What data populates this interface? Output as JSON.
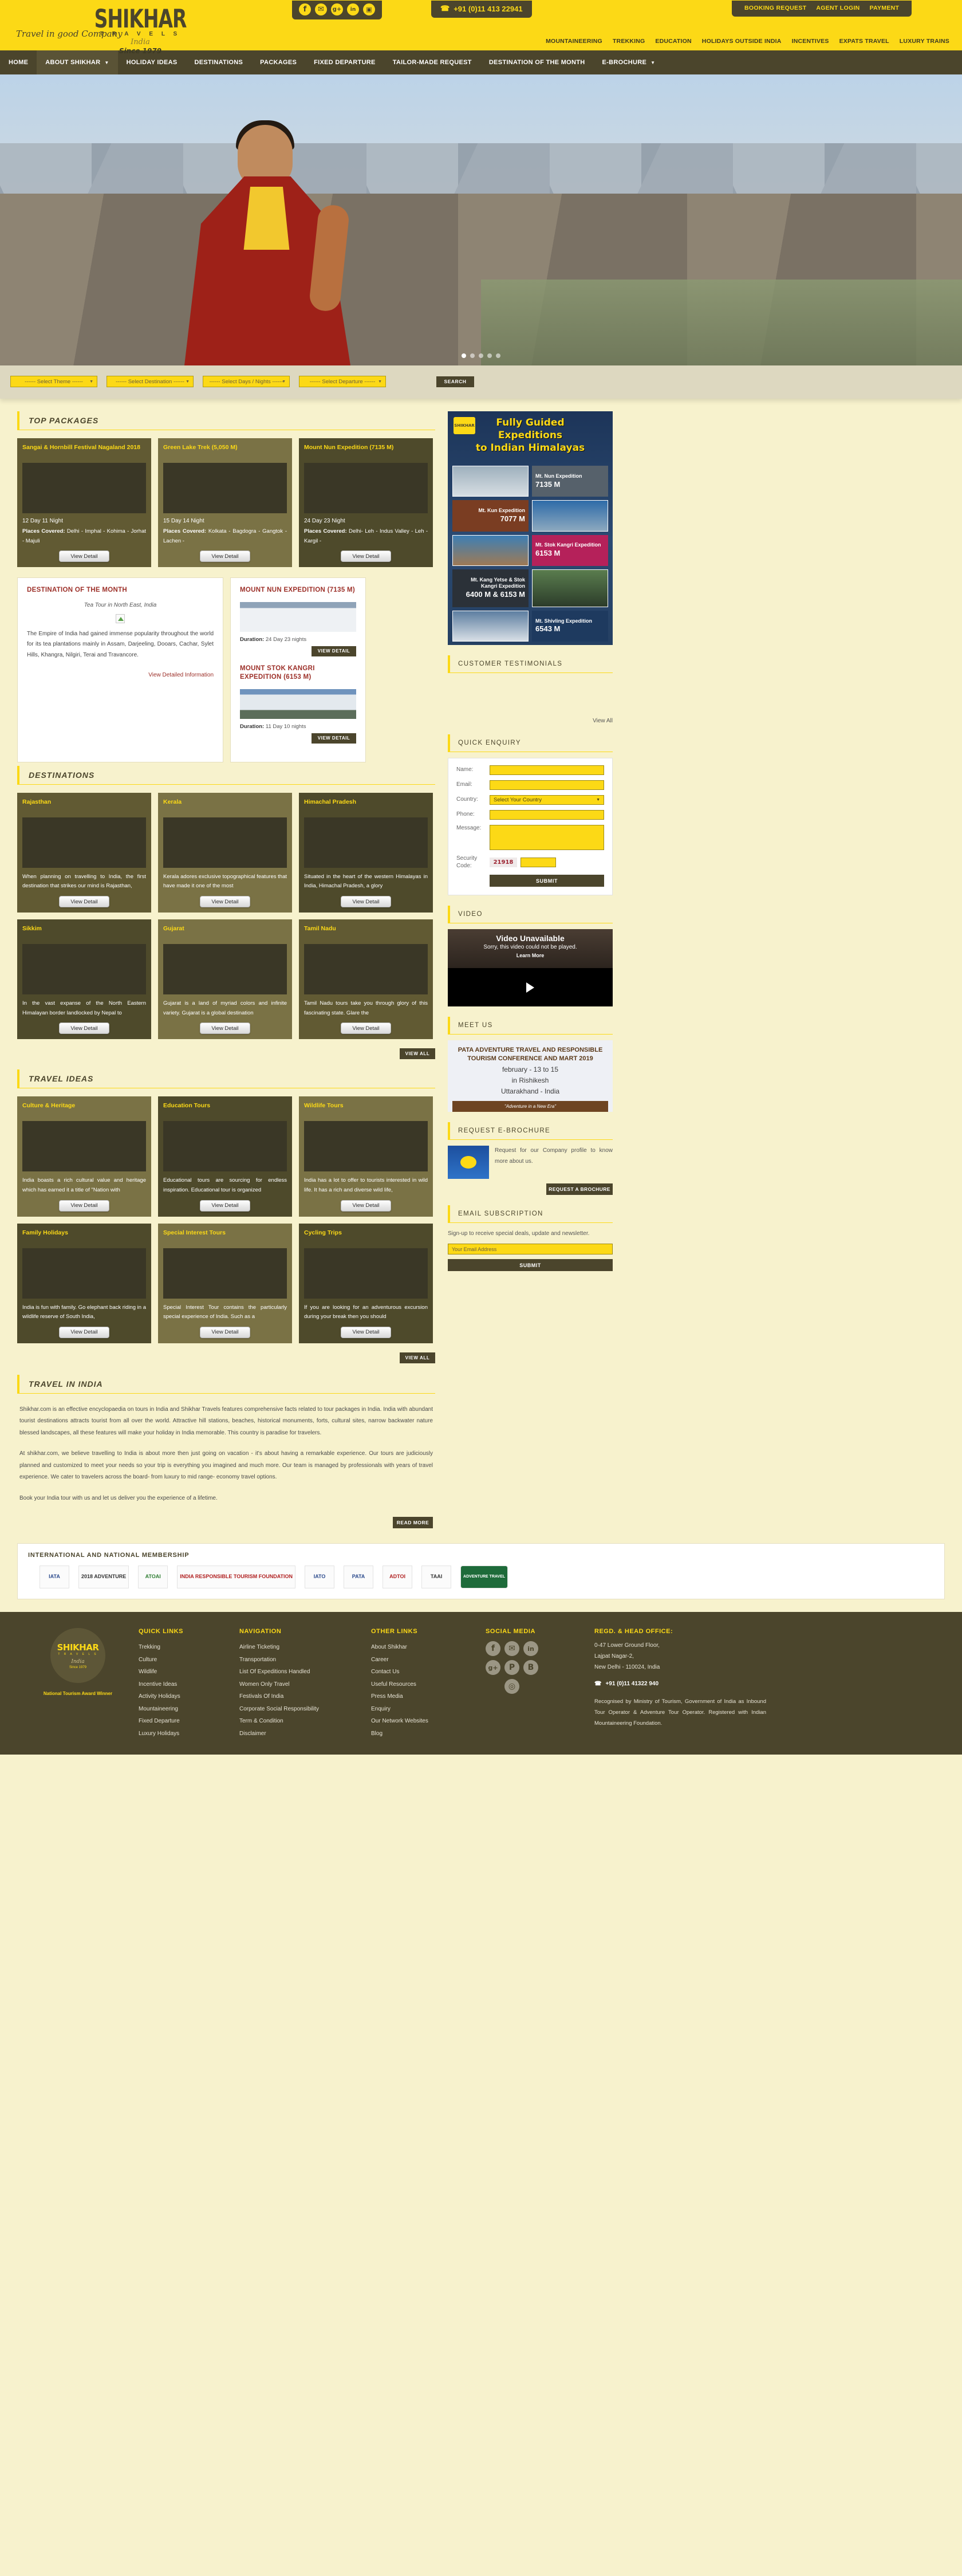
{
  "header": {
    "logo": {
      "name": "SHIKHAR",
      "sub": "T R A V E L S",
      "script": "India",
      "since": "Since 1979"
    },
    "tagline": "Travel in good Company",
    "phone": "+91 (0)11 413 22941",
    "social": [
      {
        "name": "facebook-icon",
        "glyph": "f"
      },
      {
        "name": "twitter-icon",
        "glyph": "✉"
      },
      {
        "name": "googleplus-icon",
        "glyph": "g+"
      },
      {
        "name": "linkedin-icon",
        "glyph": "in"
      },
      {
        "name": "instagram-icon",
        "glyph": "▣"
      }
    ],
    "top_links": [
      "BOOKING REQUEST",
      "AGENT LOGIN",
      "PAYMENT"
    ],
    "category_links": [
      "MOUNTAINEERING",
      "TREKKING",
      "EDUCATION",
      "HOLIDAYS OUTSIDE INDIA",
      "INCENTIVES",
      "EXPATS TRAVEL",
      "LUXURY TRAINS"
    ]
  },
  "nav": [
    {
      "label": "HOME",
      "caret": false,
      "active": false
    },
    {
      "label": "ABOUT SHIKHAR",
      "caret": true,
      "active": true
    },
    {
      "label": "HOLIDAY IDEAS",
      "caret": false,
      "active": false
    },
    {
      "label": "DESTINATIONS",
      "caret": false,
      "active": false
    },
    {
      "label": "PACKAGES",
      "caret": false,
      "active": false
    },
    {
      "label": "FIXED DEPARTURE",
      "caret": false,
      "active": false
    },
    {
      "label": "TAILOR-MADE REQUEST",
      "caret": false,
      "active": false
    },
    {
      "label": "DESTINATION OF THE MONTH",
      "caret": false,
      "active": false
    },
    {
      "label": "E-BROCHURE",
      "caret": true,
      "active": false
    }
  ],
  "search": {
    "theme": "------ Select Theme ------",
    "destination": "------ Select Destination ------",
    "days": "------ Select Days / Nights ------",
    "departure": "------ Select Departure ------",
    "button": "SEARCH"
  },
  "sections": {
    "top_packages": "TOP PACKAGES",
    "destinations": "DESTINATIONS",
    "travel_ideas": "TRAVEL IDEAS",
    "travel_in_india": "TRAVEL IN INDIA"
  },
  "top_packages": [
    {
      "title": "Sangai & Hornbill Festival Nagaland 2018",
      "duration": "12 Day 11 Night",
      "places_label": "Places Covered:",
      "places": "Delhi - Imphal - Kohima - Jorhat - Majuli",
      "button": "View Detail"
    },
    {
      "title": "Green Lake Trek (5,050 M)",
      "duration": "15 Day 14 Night",
      "places_label": "Places Covered:",
      "places": "Kolkata - Bagdogra - Gangtok - Lachen -",
      "button": "View Detail"
    },
    {
      "title": "Mount Nun Expedition (7135 M)",
      "duration": "24 Day 23 Night",
      "places_label": "Places Covered:",
      "places": "Delhi- Leh - Indus Valley - Leh - Kargil -",
      "button": "View Detail"
    }
  ],
  "destination_of_month": {
    "heading": "DESTINATION OF THE MONTH",
    "subtitle": "Tea Tour in North East, India",
    "text": "The Empire of India had gained immense popularity throughout the world for its tea plantations mainly in Assam, Darjeeling, Dooars, Cachar, Sylet Hills, Khangra, Nilgiri, Terai and Travancore.",
    "link": "View Detailed Information"
  },
  "expeditions": [
    {
      "title": "MOUNT NUN EXPEDITION (7135 M)",
      "duration_label": "Duration:",
      "duration": "24 Day 23 nights",
      "button": "VIEW DETAIL"
    },
    {
      "title": "MOUNT STOK KANGRI EXPEDITION (6153 M)",
      "duration_label": "Duration:",
      "duration": "11 Day 10 nights",
      "button": "VIEW DETAIL"
    }
  ],
  "destinations": [
    {
      "title": "Rajasthan",
      "text": "When planning on travelling to India, the first destination that strikes our mind is Rajasthan,",
      "button": "View Detail"
    },
    {
      "title": "Kerala",
      "text": "Kerala adores exclusive topographical features that have made it one of the most",
      "button": "View Detail"
    },
    {
      "title": "Himachal Pradesh",
      "text": "Situated in the heart of the western Himalayas in India, Himachal Pradesh, a glory",
      "button": "View Detail"
    },
    {
      "title": "Sikkim",
      "text": "In the vast expanse of the North Eastern Himalayan border landlocked by Nepal to",
      "button": "View Detail"
    },
    {
      "title": "Gujarat",
      "text": "Gujarat is a land of myriad colors and infinite variety. Gujarat is a global destination",
      "button": "View Detail"
    },
    {
      "title": "Tamil Nadu",
      "text": "Tamil Nadu tours take you through glory of this fascinating state. Glare the",
      "button": "View Detail"
    }
  ],
  "destinations_viewall": "VIEW ALL",
  "travel_ideas": [
    {
      "title": "Culture & Heritage",
      "text": "India boasts a rich cultural value and heritage which has earned it a title of \"Nation with",
      "button": "View Detail"
    },
    {
      "title": "Education Tours",
      "text": "Educational tours are sourcing for endless inspiration. Educational tour is organized",
      "button": "View Detail"
    },
    {
      "title": "Wildlife Tours",
      "text": "India has a lot to offer to tourists interested in wild life. It has a rich and diverse wild life,",
      "button": "View Detail"
    },
    {
      "title": "Family Holidays",
      "text": "India is fun with family. Go elephant back riding in a wildlife reserve of South India,",
      "button": "View Detail"
    },
    {
      "title": "Special Interest Tours",
      "text": "Special Interest Tour contains the particularly special experience of India. Such as a",
      "button": "View Detail"
    },
    {
      "title": "Cycling Trips",
      "text": "If you are looking for an adventurous excursion during your break then you should",
      "button": "View Detail"
    }
  ],
  "travel_ideas_viewall": "VIEW ALL",
  "travel_in_india": {
    "p1": "Shikhar.com is an effective encyclopaedia on tours in India and Shikhar Travels features comprehensive facts related to tour packages in India. India with abundant tourist destinations attracts tourist from all over the world. Attractive hill stations, beaches, historical monuments, forts, cultural sites, narrow backwater nature blessed landscapes, all these features will make your holiday in India memorable. This country is paradise for travelers.",
    "p2": "At shikhar.com, we believe travelling to India is about more then just going on vacation - it's about having a remarkable experience. Our tours are judiciously planned and customized to meet your needs so your trip is everything you imagined and much more. Our team is managed by professionals with years of travel experience. We cater to travelers across the board- from luxury to mid range- economy travel options.",
    "p3": "Book your India tour with us and let us deliver you the experience of a lifetime.",
    "button": "READ MORE"
  },
  "sidebar": {
    "banner": {
      "logo": "SHIKHAR",
      "title_line1": "Fully Guided",
      "title_line2": "Expeditions",
      "title_line3": "to Indian Himalayas",
      "cells": [
        {
          "text": "Mt. Nun Expedition",
          "value": "7135 M"
        },
        {
          "text": "Mt. Kun Expedition",
          "value": "7077 M"
        },
        {
          "text": "Mt. Stok Kangri Expedition",
          "value": "6153 M"
        },
        {
          "text": "Mt. Kang Yetse & Stok Kangri Expedition",
          "value": "6400 M & 6153 M"
        },
        {
          "text": "Mt. Shivling Expedition",
          "value": "6543 M"
        }
      ]
    },
    "testimonials_heading": "CUSTOMER TESTIMONIALS",
    "testimonials_viewall": "View All",
    "quick_enquiry": {
      "heading": "QUICK ENQUIRY",
      "name_label": "Name:",
      "email_label": "Email:",
      "country_label": "Country:",
      "country_value": "Select Your Country",
      "phone_label": "Phone:",
      "message_label": "Message:",
      "security_label": "Security Code:",
      "captcha": "21918",
      "submit": "SUBMIT"
    },
    "video": {
      "heading": "VIDEO",
      "title": "Video Unavailable",
      "subtitle": "Sorry, this video could not be played.",
      "link": "Learn More"
    },
    "meet_us": {
      "heading": "MEET US",
      "line1": "PATA ADVENTURE TRAVEL AND RESPONSIBLE TOURISM CONFERENCE AND MART  2019",
      "line2": "february - 13 to 15",
      "line3": "in Rishikesh",
      "line4": "Uttarakhand - India",
      "strip": "\"Adventure in a New Era\""
    },
    "ebrochure": {
      "heading": "REQUEST E-BROCHURE",
      "text": "Request for our Company profile to know more about us.",
      "button": "REQUEST A BROCHURE"
    },
    "subscription": {
      "heading": "EMAIL SUBSCRIPTION",
      "text": "Sign-up to receive special deals, update and newsletter.",
      "placeholder": "Your Email Address",
      "button": "SUBMIT"
    }
  },
  "memberships": {
    "heading": "INTERNATIONAL AND NATIONAL MEMBERSHIP",
    "logos": [
      "IATA",
      "2018 ADVENTURE",
      "ATOAI",
      "INDIA RESPONSIBLE TOURISM FOUNDATION",
      "IATO",
      "PATA",
      "ADTOI",
      "TAAI",
      "ADVENTURE TRAVEL"
    ]
  },
  "footer": {
    "brand": {
      "name": "SHIKHAR",
      "sub": "T R A V E L S",
      "script": "India",
      "since": "Since 1979"
    },
    "award": "National Tourism Award Winner",
    "quick_links_heading": "QUICK LINKS",
    "quick_links": [
      "Trekking",
      "Culture",
      "Wildlife",
      "Incentive Ideas",
      "Activity Holidays",
      "Mountaineering",
      "Fixed Departure",
      "Luxury Holidays"
    ],
    "navigation_heading": "NAVIGATION",
    "navigation": [
      "Airline Ticketing",
      "Transportation",
      "List Of Expeditions Handled",
      "Women Only Travel",
      "Festivals Of India",
      "Corporate Social Responsibility",
      "Term & Condition",
      "Disclaimer"
    ],
    "other_heading": "OTHER LINKS",
    "other_links": [
      "About Shikhar",
      "Career",
      "Contact Us",
      "Useful Resources",
      "Press Media",
      "Enquiry",
      "Our Network Websites",
      "Blog"
    ],
    "social_heading": "SOCIAL MEDIA",
    "social": [
      {
        "name": "facebook-icon",
        "glyph": "f"
      },
      {
        "name": "twitter-icon",
        "glyph": "✉"
      },
      {
        "name": "linkedin-icon",
        "glyph": "in"
      },
      {
        "name": "googleplus-icon",
        "glyph": "g+"
      },
      {
        "name": "pinterest-icon",
        "glyph": "P"
      },
      {
        "name": "blogger-icon",
        "glyph": "B"
      },
      {
        "name": "tripadvisor-icon",
        "glyph": "◎"
      }
    ],
    "office_heading": "REGD. & HEAD OFFICE:",
    "office_line1": "0-47 Lower Ground Floor,",
    "office_line2": "Lajpat Nagar-2,",
    "office_line3": "New Delhi - 110024, India",
    "office_phone": "+91 (0)11 41322 940",
    "recognition": "Recognised by Ministry of Tourism, Government of India as Inbound Tour Operator & Adventure Tour Operator. Registered with Indian Mountaineering Foundation."
  },
  "colors": {
    "brand_yellow": "#fcd916",
    "brand_dark": "#4b452c",
    "page_bg": "#f7f2cd",
    "accent_red": "#9c2f28"
  }
}
